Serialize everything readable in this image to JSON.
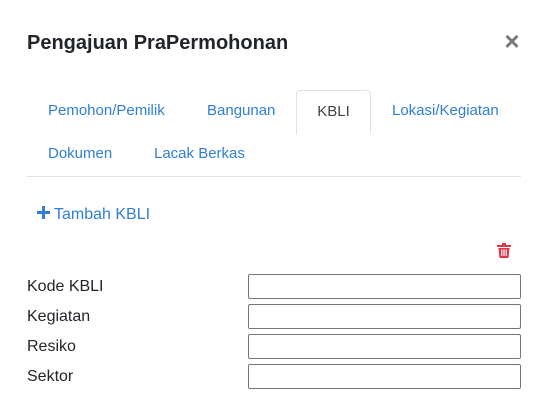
{
  "modal": {
    "title": "Pengajuan PraPermohonan",
    "close_label": "×"
  },
  "tabs": [
    {
      "label": "Pemohon/Pemilik",
      "active": false
    },
    {
      "label": "Bangunan",
      "active": false
    },
    {
      "label": "KBLI",
      "active": true
    },
    {
      "label": "Lokasi/Kegiatan",
      "active": false
    },
    {
      "label": "Dokumen",
      "active": false
    },
    {
      "label": "Lacak Berkas",
      "active": false
    }
  ],
  "actions": {
    "add_label": "Tambah KBLI",
    "add_icon": "plus-icon",
    "delete_icon": "trash-icon"
  },
  "form": {
    "fields": [
      {
        "label": "Kode KBLI",
        "value": ""
      },
      {
        "label": "Kegiatan",
        "value": ""
      },
      {
        "label": "Resiko",
        "value": ""
      },
      {
        "label": "Sektor",
        "value": ""
      }
    ]
  },
  "colors": {
    "link": "#2f7fd6",
    "danger": "#dc3545",
    "border": "#dee2e6"
  }
}
